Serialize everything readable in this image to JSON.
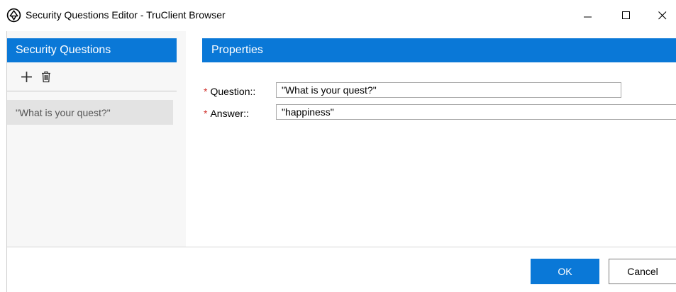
{
  "window": {
    "title": "Security Questions Editor - TruClient Browser",
    "icon": "truclient-logo-icon",
    "controls": {
      "minimize": "minimize-icon",
      "maximize": "maximize-icon",
      "close": "close-icon"
    }
  },
  "sidebar": {
    "header": "Security Questions",
    "toolbar": {
      "add_icon": "plus-icon",
      "delete_icon": "trash-icon"
    },
    "items": [
      {
        "label": "\"What is your quest?\"",
        "selected": true
      }
    ]
  },
  "properties": {
    "header": "Properties",
    "fields": [
      {
        "required_mark": "*",
        "label": "Question::",
        "value": "\"What is your quest?\""
      },
      {
        "required_mark": "*",
        "label": "Answer::",
        "value": "\"happiness\""
      }
    ]
  },
  "footer": {
    "ok_label": "OK",
    "cancel_label": "Cancel"
  },
  "colors": {
    "accent": "#0a78d7",
    "required": "#d0312d",
    "selected_bg": "#e3e3e3"
  }
}
